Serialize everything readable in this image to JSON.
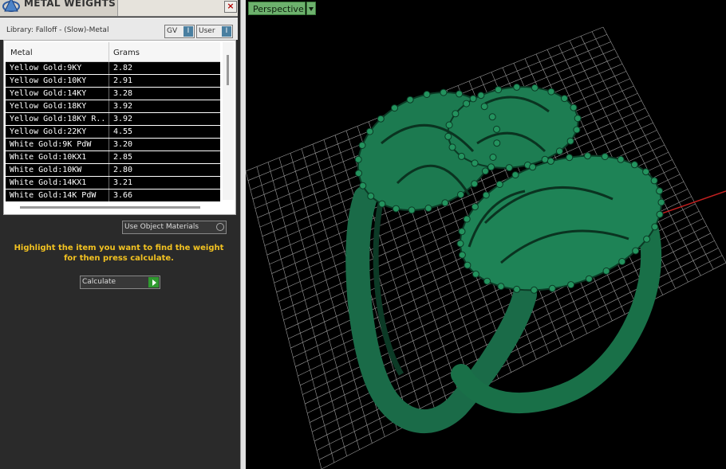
{
  "panel": {
    "title": "METAL WEIGHTS",
    "close_icon": "×",
    "library_label": "Library: Falloff - (Slow)-Metal",
    "toggle_gv": "GV",
    "toggle_user": "User",
    "toggle_indicator": "I",
    "columns": [
      "Metal",
      "Grams"
    ],
    "rows": [
      {
        "metal": "Yellow Gold:9KY",
        "grams": "2.82"
      },
      {
        "metal": "Yellow Gold:10KY",
        "grams": "2.91"
      },
      {
        "metal": "Yellow Gold:14KY",
        "grams": "3.28"
      },
      {
        "metal": "Yellow Gold:18KY",
        "grams": "3.92"
      },
      {
        "metal": "Yellow Gold:18KY R...",
        "grams": "3.92"
      },
      {
        "metal": "Yellow Gold:22KY",
        "grams": "4.55"
      },
      {
        "metal": "White Gold:9K PdW",
        "grams": "3.20"
      },
      {
        "metal": "White Gold:10KX1",
        "grams": "2.85"
      },
      {
        "metal": "White Gold:10KW",
        "grams": "2.80"
      },
      {
        "metal": "White Gold:14KX1",
        "grams": "3.21"
      },
      {
        "metal": "White Gold:14K PdW",
        "grams": "3.66"
      }
    ],
    "use_object_materials": "Use Object Materials",
    "hint": "Highlight the item you want to find the weight for then press calculate.",
    "calculate": "Calculate"
  },
  "viewport": {
    "view_name": "Perspective",
    "model_color": "#1e7a52",
    "grid_color": "#9a9a9a",
    "x_axis_color": "#c02020",
    "y_axis_color": "#1f8f8f"
  },
  "icons": [
    "app-logo-icon",
    "close-icon",
    "calculate-arrow-icon",
    "dropdown-arrow-icon"
  ]
}
